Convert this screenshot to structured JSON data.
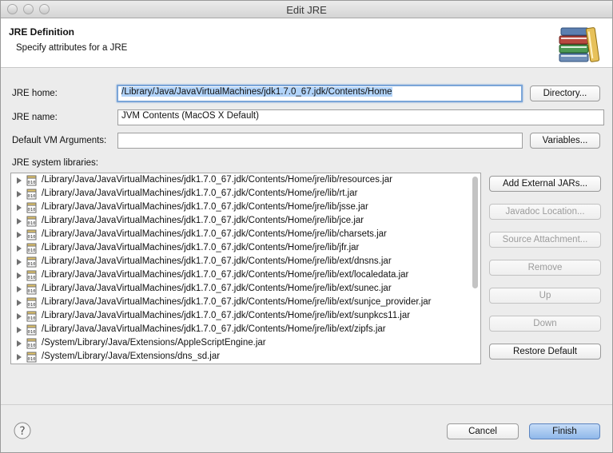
{
  "window": {
    "title": "Edit JRE"
  },
  "banner": {
    "title": "JRE Definition",
    "subtitle": "Specify attributes for a JRE",
    "icon": "library-books-icon"
  },
  "form": {
    "jre_home_label": "JRE home:",
    "jre_home_value": "/Library/Java/JavaVirtualMachines/jdk1.7.0_67.jdk/Contents/Home",
    "directory_button": "Directory...",
    "jre_name_label": "JRE name:",
    "jre_name_value": "JVM Contents (MacOS X Default)",
    "vm_args_label": "Default VM Arguments:",
    "vm_args_value": "",
    "variables_button": "Variables..."
  },
  "libraries": {
    "label": "JRE system libraries:",
    "items": [
      "/Library/Java/JavaVirtualMachines/jdk1.7.0_67.jdk/Contents/Home/jre/lib/resources.jar",
      "/Library/Java/JavaVirtualMachines/jdk1.7.0_67.jdk/Contents/Home/jre/lib/rt.jar",
      "/Library/Java/JavaVirtualMachines/jdk1.7.0_67.jdk/Contents/Home/jre/lib/jsse.jar",
      "/Library/Java/JavaVirtualMachines/jdk1.7.0_67.jdk/Contents/Home/jre/lib/jce.jar",
      "/Library/Java/JavaVirtualMachines/jdk1.7.0_67.jdk/Contents/Home/jre/lib/charsets.jar",
      "/Library/Java/JavaVirtualMachines/jdk1.7.0_67.jdk/Contents/Home/jre/lib/jfr.jar",
      "/Library/Java/JavaVirtualMachines/jdk1.7.0_67.jdk/Contents/Home/jre/lib/ext/dnsns.jar",
      "/Library/Java/JavaVirtualMachines/jdk1.7.0_67.jdk/Contents/Home/jre/lib/ext/localedata.jar",
      "/Library/Java/JavaVirtualMachines/jdk1.7.0_67.jdk/Contents/Home/jre/lib/ext/sunec.jar",
      "/Library/Java/JavaVirtualMachines/jdk1.7.0_67.jdk/Contents/Home/jre/lib/ext/sunjce_provider.jar",
      "/Library/Java/JavaVirtualMachines/jdk1.7.0_67.jdk/Contents/Home/jre/lib/ext/sunpkcs11.jar",
      "/Library/Java/JavaVirtualMachines/jdk1.7.0_67.jdk/Contents/Home/jre/lib/ext/zipfs.jar",
      "/System/Library/Java/Extensions/AppleScriptEngine.jar",
      "/System/Library/Java/Extensions/dns_sd.jar"
    ]
  },
  "side_buttons": {
    "add_external_jars": "Add External JARs...",
    "javadoc_location": "Javadoc Location...",
    "source_attachment": "Source Attachment...",
    "remove": "Remove",
    "up": "Up",
    "down": "Down",
    "restore_default": "Restore Default"
  },
  "footer": {
    "help_icon": "help-icon",
    "cancel": "Cancel",
    "finish": "Finish"
  }
}
